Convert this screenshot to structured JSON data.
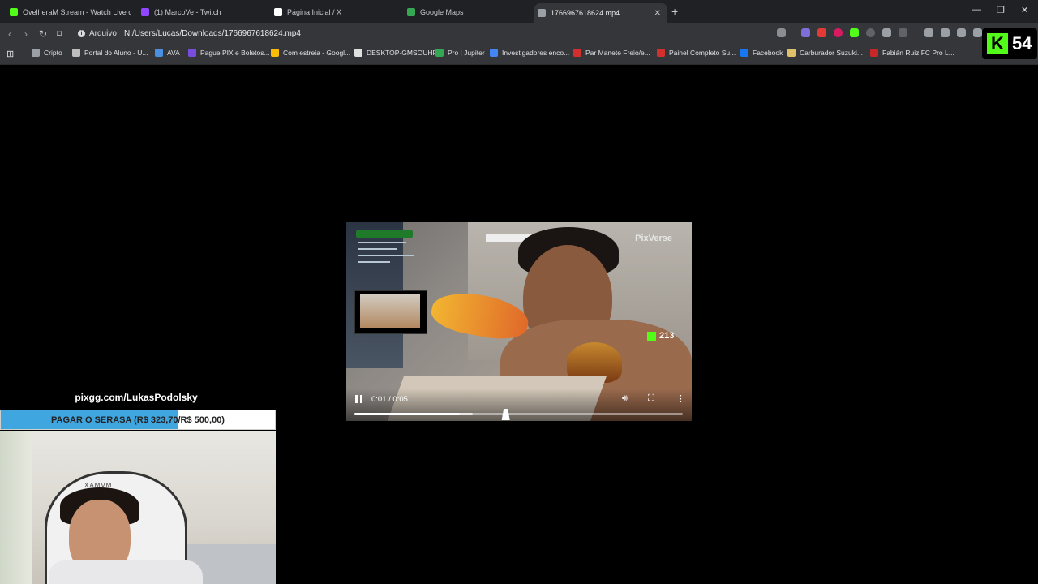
{
  "browser": {
    "tabs": [
      {
        "label": "OvelheraM Stream - Watch Live o",
        "favicon": "kick-icon",
        "color": "#53fc18",
        "active": false
      },
      {
        "label": "(1) MarcoVe - Twitch",
        "favicon": "twitch-icon",
        "color": "#9146ff",
        "active": false
      },
      {
        "label": "Página Inicial / X",
        "favicon": "x-icon",
        "color": "#ffffff",
        "active": false
      },
      {
        "label": "Google Maps",
        "favicon": "maps-icon",
        "color": "#34a853",
        "active": false
      },
      {
        "label": "1766967618624.mp4",
        "favicon": "audio-playing-icon",
        "color": "#9aa0a6",
        "active": true
      }
    ],
    "site_info_label": "Arquivo",
    "url": "N:/Users/Lucas/Downloads/1766967618624.mp4",
    "bookmarks": [
      {
        "label": "Cripto",
        "color": "#9aa0a6"
      },
      {
        "label": "Portal do Aluno - U...",
        "color": "#bdbdbd"
      },
      {
        "label": "AVA",
        "color": "#4a90e2"
      },
      {
        "label": "Pague PIX e Boletos...",
        "color": "#7b4ce0"
      },
      {
        "label": "Com estreia - Googl...",
        "color": "#fbbc05"
      },
      {
        "label": "DESKTOP-GMSOUHF",
        "color": "#e0e0e0"
      },
      {
        "label": "Pro | Jupiter",
        "color": "#34a853"
      },
      {
        "label": "Investigadores enco...",
        "color": "#4285f4"
      },
      {
        "label": "Par Manete Freio/e...",
        "color": "#d32f2f"
      },
      {
        "label": "Painel Completo Su...",
        "color": "#d32f2f"
      },
      {
        "label": "Facebook",
        "color": "#1877f2"
      },
      {
        "label": "Carburador Suzuki...",
        "color": "#e0c16b"
      },
      {
        "label": "Fabián Ruiz FC Pro L...",
        "color": "#c62828"
      }
    ]
  },
  "kick_viewers": {
    "count": "54",
    "color": "#53fc18"
  },
  "video_player": {
    "time_display": "0:01 / 0:05",
    "progress_fraction": 0.32,
    "buffered_fraction": 0.36,
    "state": "playing",
    "watermark": "PixVerse",
    "inset_kick_count": "213"
  },
  "stream_overlay": {
    "donation_url": "pixgg.com/LukasPodolsky",
    "goal_text": "PAGAR O SERASA (R$ 323,70/R$ 500,00)",
    "goal_fraction": 0.6474,
    "chair_brand": "XAMVM"
  }
}
